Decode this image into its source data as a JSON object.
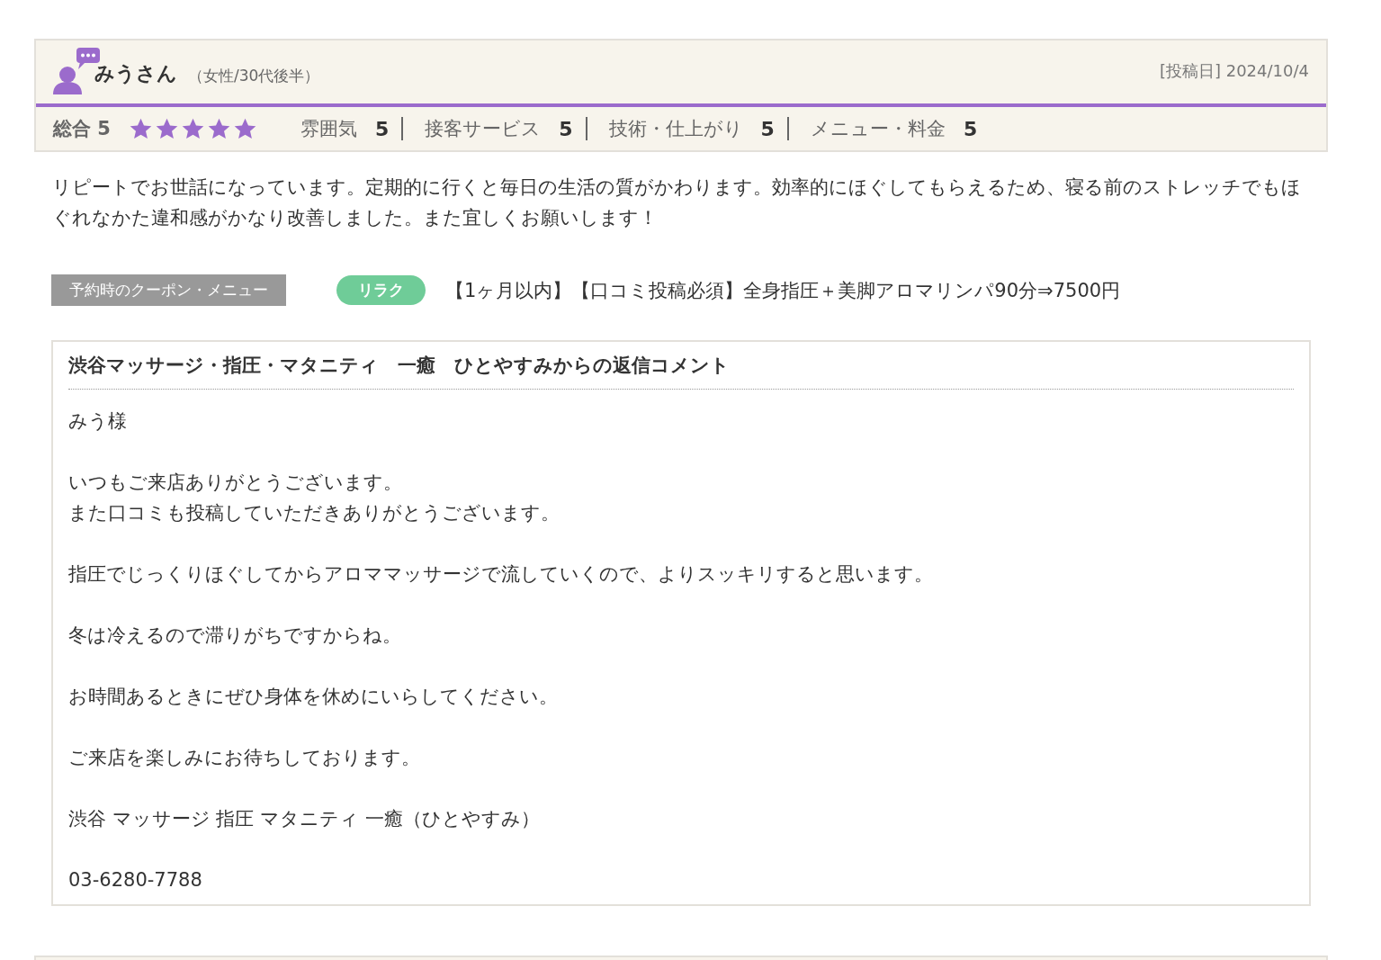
{
  "review": {
    "reviewer": {
      "name": "みうさん",
      "profile": "（女性/30代後半）"
    },
    "posted": "[投稿日] 2024/10/4",
    "overall": {
      "label": "総合",
      "score": "5",
      "stars": 5
    },
    "ratings": [
      {
        "label": "雰囲気",
        "score": "5"
      },
      {
        "label": "接客サービス",
        "score": "5"
      },
      {
        "label": "技術・仕上がり",
        "score": "5"
      },
      {
        "label": "メニュー・料金",
        "score": "5"
      }
    ],
    "text": "リピートでお世話になっています。定期的に行くと毎日の生活の質がかわります。効率的にほぐしてもらえるため、寝る前のストレッチでもほぐれなかた違和感がかなり改善しました。また宜しくお願いします！",
    "coupon": {
      "label": "予約時のクーポン・メニュー",
      "tag": "リラク",
      "name": "【1ヶ月以内】【口コミ投稿必須】全身指圧＋美脚アロマリンパ90分⇒7500円"
    },
    "reply": {
      "title": "渋谷マッサージ・指圧・マタニティ　一癒　ひとやすみからの返信コメント",
      "paragraphs": [
        [
          "みう様"
        ],
        [
          "いつもご来店ありがとうございます。",
          "また口コミも投稿していただきありがとうございます。"
        ],
        [
          "指圧でじっくりほぐしてからアロママッサージで流していくので、よりスッキリすると思います。"
        ],
        [
          "冬は冷えるので滞りがちですからね。"
        ],
        [
          "お時間あるときにぜひ身体を休めにいらしてください。"
        ],
        [
          "ご来店を楽しみにお待ちしております。"
        ],
        [
          "渋谷 マッサージ 指圧 マタニティ 一癒（ひとやすみ）"
        ],
        [
          "03-6280-7788"
        ]
      ]
    }
  }
}
